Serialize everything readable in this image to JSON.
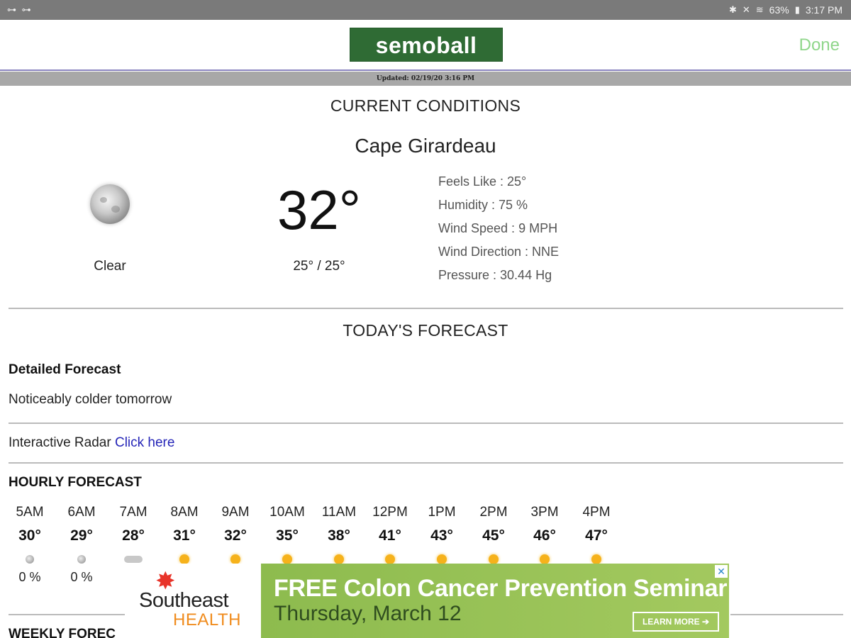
{
  "status_bar": {
    "left_icons": "key-icon key-icon",
    "battery": "63%",
    "time": "3:17 PM"
  },
  "header": {
    "logo": "semoball",
    "done_label": "Done",
    "updated": "Updated: 02/19/20 3:16 PM"
  },
  "current": {
    "section_title": "CURRENT CONDITIONS",
    "city": "Cape Girardeau",
    "condition": "Clear",
    "condition_icon": "moon-icon",
    "temperature": "32°",
    "hi_lo": "25° / 25°",
    "details": [
      "Feels Like : 25°",
      "Humidity : 75 %",
      "Wind Speed : 9 MPH",
      "Wind Direction : NNE",
      "Pressure : 30.44 Hg"
    ]
  },
  "today": {
    "section_title": "TODAY'S FORECAST",
    "detailed_heading": "Detailed Forecast",
    "detailed_text": "Noticeably colder tomorrow",
    "radar_label": "Interactive Radar",
    "radar_link": "Click here"
  },
  "hourly": {
    "heading": "HOURLY FORECAST",
    "items": [
      {
        "time": "5AM",
        "temp": "30°",
        "icon": "moon-icon",
        "pct": "0 %"
      },
      {
        "time": "6AM",
        "temp": "29°",
        "icon": "moon-icon",
        "pct": "0 %"
      },
      {
        "time": "7AM",
        "temp": "28°",
        "icon": "cloud-icon",
        "pct": ""
      },
      {
        "time": "8AM",
        "temp": "31°",
        "icon": "sun-icon",
        "pct": ""
      },
      {
        "time": "9AM",
        "temp": "32°",
        "icon": "sun-icon",
        "pct": ""
      },
      {
        "time": "10AM",
        "temp": "35°",
        "icon": "sun-icon",
        "pct": ""
      },
      {
        "time": "11AM",
        "temp": "38°",
        "icon": "sun-icon",
        "pct": ""
      },
      {
        "time": "12PM",
        "temp": "41°",
        "icon": "sun-icon",
        "pct": ""
      },
      {
        "time": "1PM",
        "temp": "43°",
        "icon": "sun-icon",
        "pct": ""
      },
      {
        "time": "2PM",
        "temp": "45°",
        "icon": "sun-icon",
        "pct": ""
      },
      {
        "time": "3PM",
        "temp": "46°",
        "icon": "sun-icon",
        "pct": ""
      },
      {
        "time": "4PM",
        "temp": "47°",
        "icon": "sun-icon",
        "pct": ""
      }
    ]
  },
  "weekly_heading": "WEEKLY FOREC",
  "ad": {
    "brand_line1": "Southeast",
    "brand_line2": "HEALTH",
    "headline": "FREE Colon Cancer Prevention Seminar",
    "subline": "Thursday, March 12",
    "button": "LEARN MORE ➔",
    "close": "✕"
  },
  "colors": {
    "logo_bg": "#2f6b34",
    "done": "#8fd68a",
    "link": "#2626b8",
    "ad_green": "#8dbb4e"
  }
}
